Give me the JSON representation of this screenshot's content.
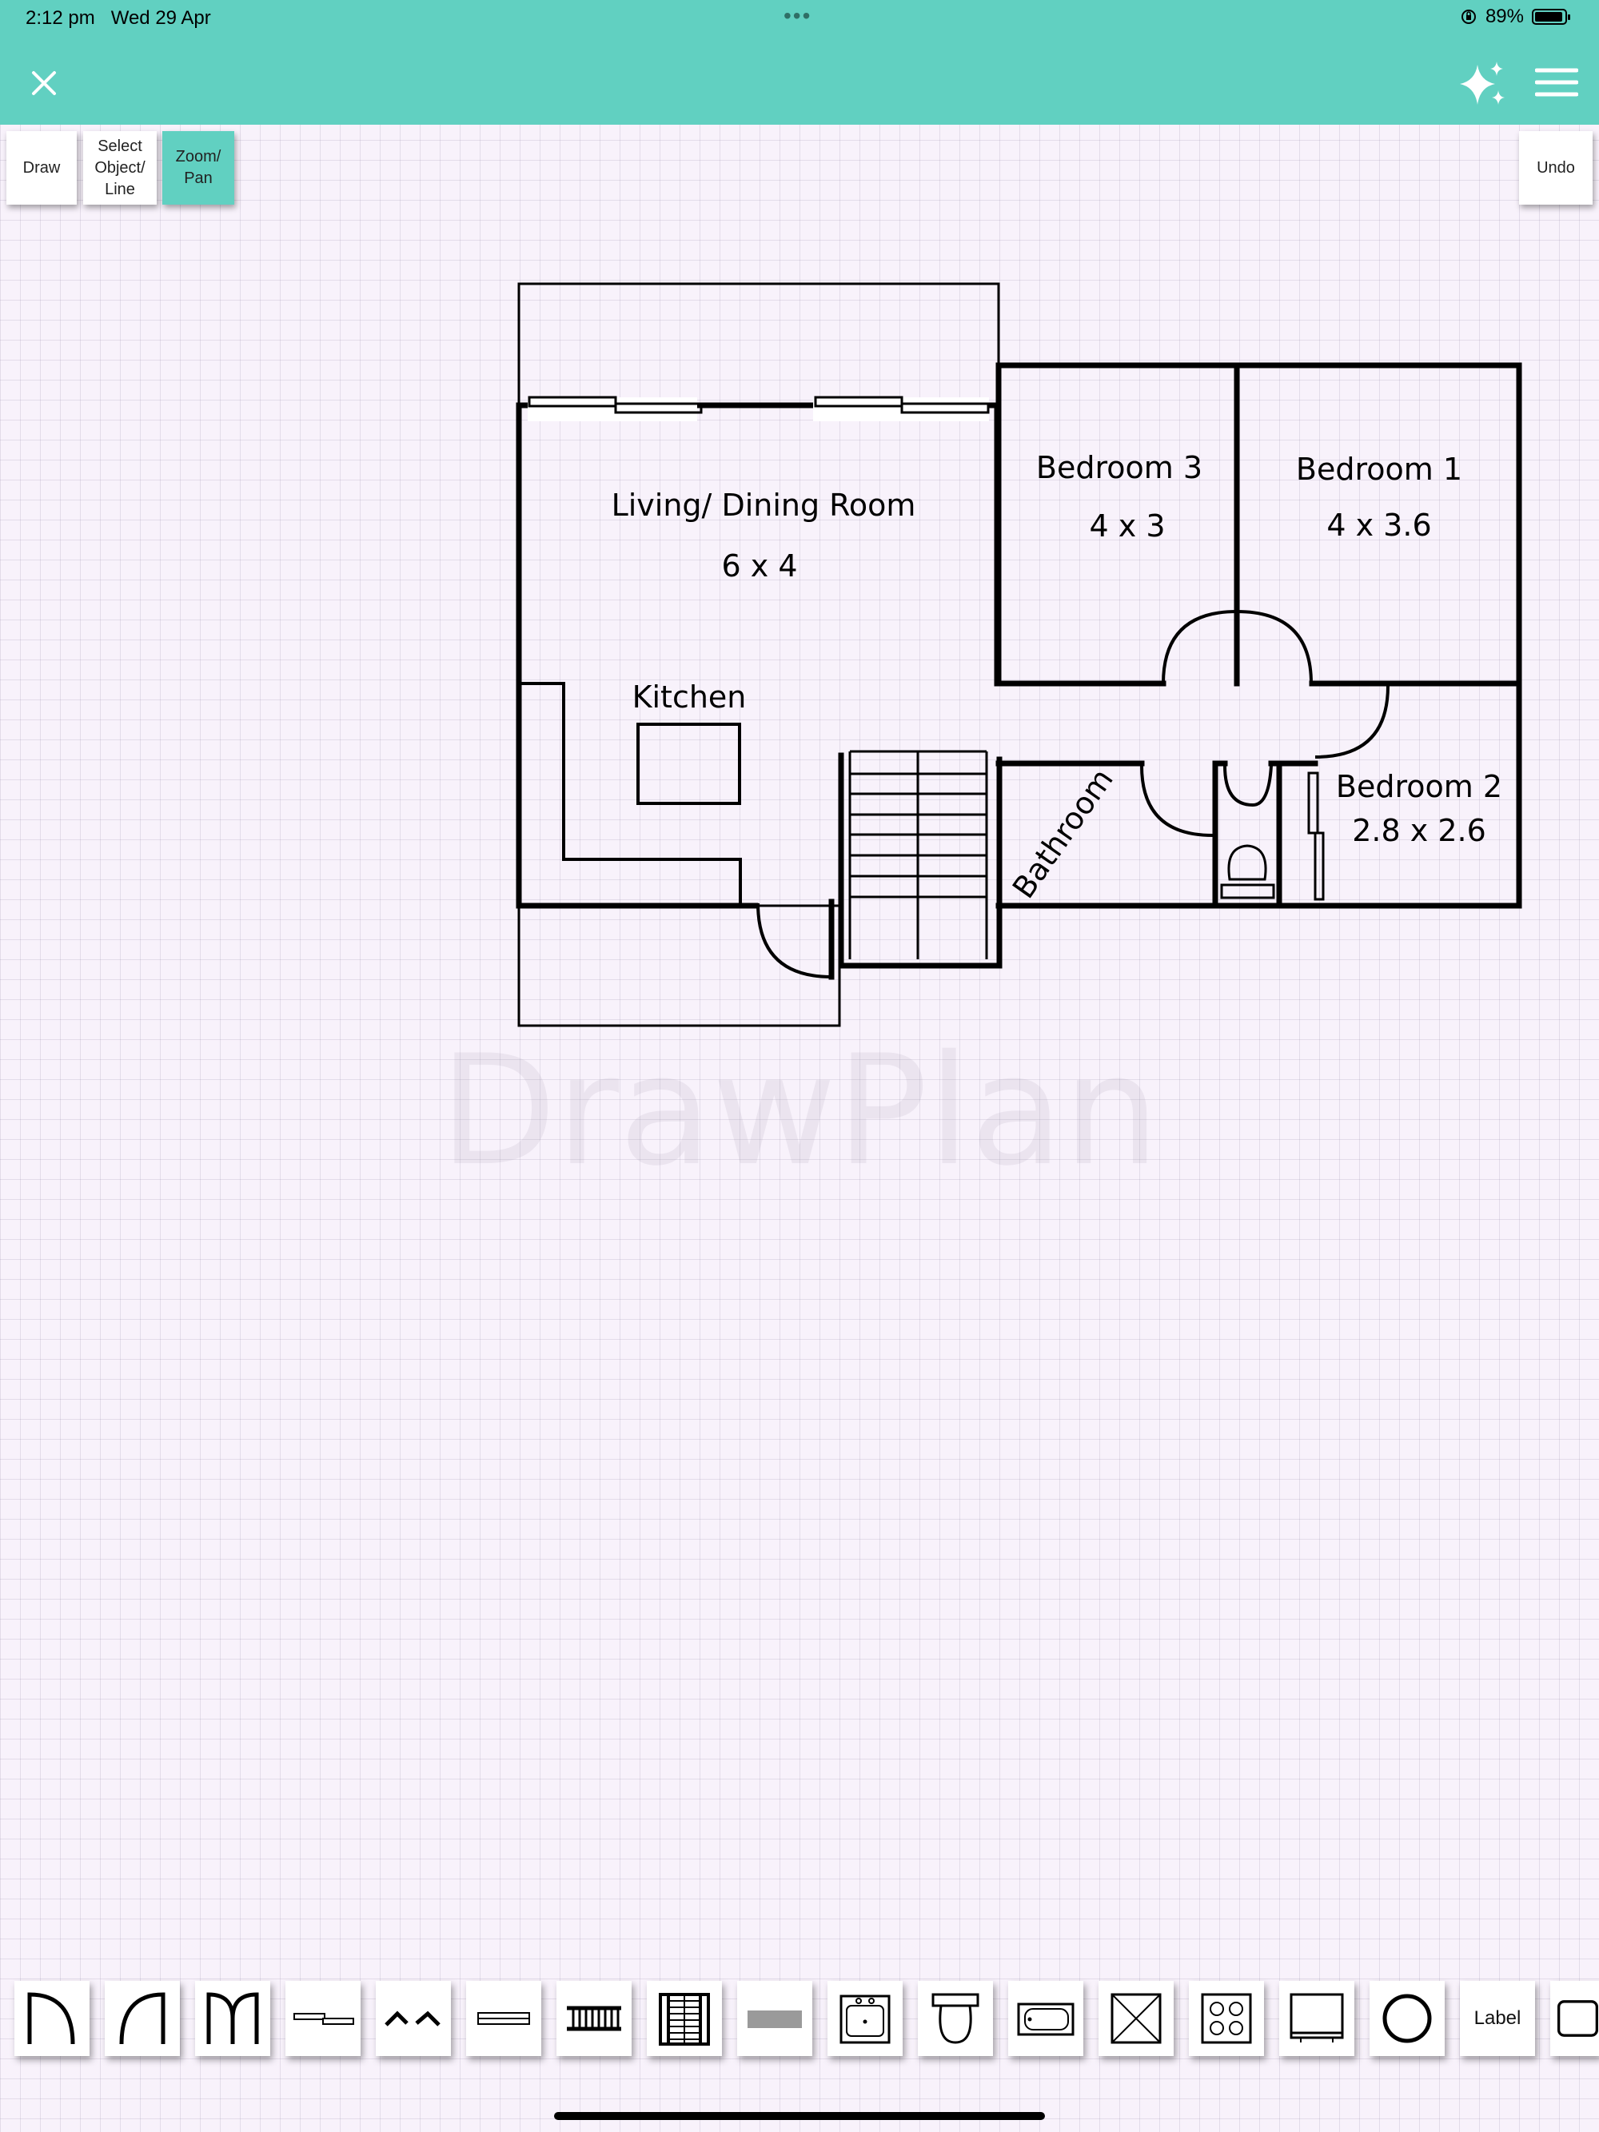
{
  "status_bar": {
    "time": "2:12 pm",
    "date": "Wed 29 Apr",
    "battery": "89%"
  },
  "toolbar": {
    "draw": "Draw",
    "select": "Select\nObject/\nLine",
    "zoom": "Zoom/\nPan",
    "undo": "Undo",
    "active": "zoom"
  },
  "plan": {
    "watermark": "DrawPlan",
    "rooms": {
      "living_name": "Living/ Dining Room",
      "living_size": "6 x 4",
      "kitchen_name": "Kitchen",
      "bedroom3_name": "Bedroom 3",
      "bedroom3_size": "4 x 3",
      "bedroom1_name": "Bedroom 1",
      "bedroom1_size": "4 x 3.6",
      "bedroom2_name": "Bedroom 2",
      "bedroom2_size": "2.8 x 2.6",
      "bathroom_name": "Bathroom"
    }
  },
  "palette": {
    "icons": [
      "door-left-icon",
      "door-right-icon",
      "double-door-icon",
      "sliding-door-icon",
      "bay-window-icon",
      "window-icon",
      "stairs-horizontal-icon",
      "stairs-vertical-icon",
      "wall-block-icon",
      "sink-icon",
      "toilet-icon",
      "bath-icon",
      "shower-icon",
      "cooktop-icon",
      "appliance-icon",
      "round-table-icon",
      "label-tool",
      "square-tool"
    ],
    "label_tool": "Label"
  },
  "colors": {
    "accent": "#61d0c1",
    "canvas": "#f8f2fb",
    "wall": "#000000"
  }
}
